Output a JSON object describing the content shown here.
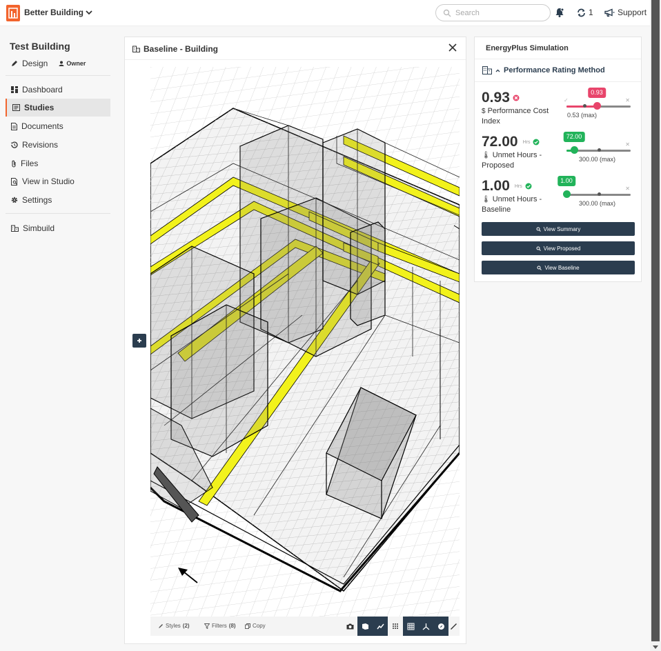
{
  "app": {
    "name": "Better Building"
  },
  "header": {
    "search_placeholder": "Search",
    "sync_count": "1",
    "support_label": "Support"
  },
  "project": {
    "title": "Test Building",
    "role": "Design",
    "owner": "Owner"
  },
  "sidebar": {
    "items": [
      {
        "label": "Dashboard",
        "icon": "dashboard-icon"
      },
      {
        "label": "Studies",
        "icon": "studies-icon"
      },
      {
        "label": "Documents",
        "icon": "document-icon"
      },
      {
        "label": "Revisions",
        "icon": "history-icon"
      },
      {
        "label": "Files",
        "icon": "paperclip-icon"
      },
      {
        "label": "View in Studio",
        "icon": "studio-icon"
      },
      {
        "label": "Settings",
        "icon": "gear-icon"
      },
      {
        "label": "Simbuild",
        "icon": "building-icon"
      }
    ]
  },
  "viewer": {
    "title": "Baseline - Building",
    "toolbar": {
      "styles_label": "Styles",
      "styles_count": "(2)",
      "filters_label": "Filters",
      "filters_count": "(8)",
      "copy_label": "Copy"
    }
  },
  "simulation": {
    "title": "EnergyPlus Simulation",
    "method": "Performance Rating Method",
    "metrics": [
      {
        "value": "0.93",
        "unit": "",
        "label": "Performance Cost Index",
        "status": "fail",
        "slider_value": "0.93",
        "slider_max": "0.53 (max)",
        "fraction": 0.47,
        "color": "#e8456b"
      },
      {
        "value": "72.00",
        "unit": "Hrs",
        "label": "Unmet Hours - Proposed",
        "status": "pass",
        "slider_value": "72.00",
        "slider_max": "300.00 (max)",
        "fraction": 0.12,
        "color": "#22b35a"
      },
      {
        "value": "1.00",
        "unit": "Hrs",
        "label": "Unmet Hours - Baseline",
        "status": "pass",
        "slider_value": "1.00",
        "slider_max": "300.00 (max)",
        "fraction": 0.0,
        "color": "#22b35a"
      }
    ],
    "buttons": {
      "summary": "View Summary",
      "proposed": "View Proposed",
      "baseline": "View Baseline"
    }
  },
  "colors": {
    "accent": "#f2642d",
    "navy": "#2b3d4f",
    "fail": "#e8456b",
    "pass": "#22b35a",
    "highlight": "#f2f21c"
  }
}
